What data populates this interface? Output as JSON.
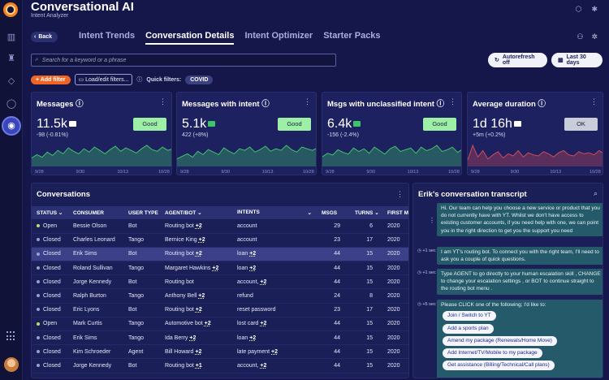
{
  "app": {
    "title": "Conversational AI",
    "subtitle": "Intent Analyzer"
  },
  "nav": {
    "back_label": "Back",
    "tabs": [
      {
        "label": "Intent Trends",
        "active": false
      },
      {
        "label": "Conversation Details",
        "active": true
      },
      {
        "label": "Intent Optimizer",
        "active": false
      },
      {
        "label": "Starter Packs",
        "active": false
      }
    ]
  },
  "search": {
    "placeholder": "Search for a keyword or a phrase"
  },
  "autorefresh": {
    "label": "Autorefresh off"
  },
  "date_range": {
    "label": "Last 30 days"
  },
  "filters": {
    "add_label": "Add filter",
    "load_label": "Load/edit filters...",
    "quick_label": "Quick filters:",
    "chips": [
      "COVID"
    ]
  },
  "colors": {
    "good": "#9eefa6",
    "ok": "#c9ccd9",
    "positive_line": "#3fc36a",
    "negative_line": "#d14a5a",
    "accent_orange": "#f06424"
  },
  "kpis": [
    {
      "title": "Messages",
      "value": "11.5k",
      "delta": "-98 (-0.81%)",
      "status": "Good",
      "status_type": "good",
      "trend": "positive",
      "icon": "trend-flat-icon",
      "x_ticks": [
        "9/28",
        "9/30",
        "10/13",
        "10/28"
      ],
      "series": [
        20,
        28,
        22,
        34,
        26,
        38,
        30,
        44,
        36,
        30,
        42,
        34,
        46,
        38,
        30,
        40,
        48,
        36,
        44,
        38,
        32,
        42,
        50,
        40,
        36,
        46,
        38,
        42
      ]
    },
    {
      "title": "Messages with intent",
      "value": "5.1k",
      "delta": "422 (+8%)",
      "status": "Good",
      "status_type": "good",
      "trend": "positive",
      "icon": "trend-up-icon",
      "x_ticks": [
        "9/28",
        "9/30",
        "10/13",
        "10/28"
      ],
      "series": [
        18,
        24,
        30,
        22,
        36,
        28,
        40,
        34,
        28,
        44,
        36,
        30,
        42,
        38,
        46,
        34,
        40,
        48,
        36,
        42,
        38,
        50,
        40,
        34,
        46,
        42,
        38,
        44
      ]
    },
    {
      "title": "Msgs with unclassified intent",
      "value": "6.4k",
      "delta": "-156 (-2.4%)",
      "status": "Good",
      "status_type": "good",
      "trend": "positive",
      "icon": "trend-down-icon",
      "x_ticks": [
        "9/28",
        "9/30",
        "10/13",
        "10/28"
      ],
      "series": [
        22,
        30,
        26,
        38,
        32,
        28,
        42,
        34,
        40,
        30,
        44,
        36,
        28,
        40,
        46,
        34,
        38,
        42,
        30,
        44,
        36,
        40,
        48,
        34,
        38,
        44,
        32,
        40
      ]
    },
    {
      "title": "Average duration",
      "value": "1d 16h",
      "delta": "+5m (+0.2%)",
      "status": "OK",
      "status_type": "ok",
      "trend": "negative",
      "icon": "trend-flat-icon",
      "x_ticks": [
        "9/28",
        "9/30",
        "10/13",
        "10/28"
      ],
      "series": [
        12,
        40,
        18,
        30,
        14,
        22,
        28,
        16,
        24,
        20,
        30,
        18,
        26,
        22,
        20,
        28,
        24,
        18,
        26,
        30,
        22,
        20,
        28,
        24,
        26,
        22,
        30,
        24
      ]
    }
  ],
  "conversations": {
    "title": "Conversations",
    "columns": [
      "STATUS",
      "CONSUMER",
      "USER TYPE",
      "AGENT/BOT",
      "INTENTS",
      "MSGS",
      "TURNS",
      "FIRST M"
    ],
    "rows": [
      {
        "status": "Open",
        "consumer": "Bessie Olson",
        "user_type": "Bot",
        "agent": "Routing bot",
        "agent_more": "+2",
        "intents": "account",
        "intents_more": "",
        "msgs": "29",
        "turns": "6",
        "first": "2020"
      },
      {
        "status": "Closed",
        "consumer": "Charles Leonard",
        "user_type": "Tango",
        "agent": "Bernice King",
        "agent_more": "+2",
        "intents": "account",
        "intents_more": "",
        "msgs": "23",
        "turns": "17",
        "first": "2020"
      },
      {
        "status": "Closed",
        "consumer": "Erik Sims",
        "user_type": "Bot",
        "agent": "Routing bot",
        "agent_more": "+2",
        "intents": "loan",
        "intents_more": "+2",
        "msgs": "44",
        "turns": "15",
        "first": "2020",
        "selected": true
      },
      {
        "status": "Closed",
        "consumer": "Roland Sullivan",
        "user_type": "Tango",
        "agent": "Margaret Hawkins",
        "agent_more": "+2",
        "intents": "loan",
        "intents_more": "+2",
        "msgs": "44",
        "turns": "15",
        "first": "2020"
      },
      {
        "status": "Closed",
        "consumer": "Jorge Kennedy",
        "user_type": "Bot",
        "agent": "Routing bot",
        "agent_more": "",
        "intents": "account,",
        "intents_more": "+2",
        "msgs": "44",
        "turns": "15",
        "first": "2020"
      },
      {
        "status": "Closed",
        "consumer": "Ralph Burton",
        "user_type": "Tango",
        "agent": "Anthony Bell",
        "agent_more": "+2",
        "intents": "refund",
        "intents_more": "",
        "msgs": "24",
        "turns": "8",
        "first": "2020"
      },
      {
        "status": "Closed",
        "consumer": "Eric Lyons",
        "user_type": "Bot",
        "agent": "Routing bot",
        "agent_more": "+2",
        "intents": "reset password",
        "intents_more": "",
        "msgs": "23",
        "turns": "17",
        "first": "2020"
      },
      {
        "status": "Open",
        "consumer": "Mark Curtis",
        "user_type": "Tango",
        "agent": "Automotive bot",
        "agent_more": "+2",
        "intents": "lost card",
        "intents_more": "+2",
        "msgs": "44",
        "turns": "15",
        "first": "2020"
      },
      {
        "status": "Closed",
        "consumer": "Erik Sims",
        "user_type": "Tango",
        "agent": "Ida Berry",
        "agent_more": "+2",
        "intents": "loan",
        "intents_more": "+2",
        "msgs": "44",
        "turns": "15",
        "first": "2020"
      },
      {
        "status": "Closed",
        "consumer": "Kim Schroeder",
        "user_type": "Agent",
        "agent": "Bill Howard",
        "agent_more": "+2",
        "intents": "late payment",
        "intents_more": "+2",
        "msgs": "44",
        "turns": "15",
        "first": "2020"
      },
      {
        "status": "Closed",
        "consumer": "Jorge Kennedy",
        "user_type": "Bot",
        "agent": "Routing bot",
        "agent_more": "+1",
        "intents": "account,",
        "intents_more": "+2",
        "msgs": "44",
        "turns": "15",
        "first": "2020"
      }
    ]
  },
  "transcript": {
    "title": "Erik's conversation transcript",
    "messages": [
      {
        "meta": "",
        "text": "Hi. Our team can help you choose a new service or product that you do not currently have with YT. Whilst we don't have access to existing customer accounts, if you need help with one, we can point you in the right direction to get you the support you need"
      },
      {
        "meta": "+1 sec",
        "text": "I am YT's routing bot. To connect you with the right team, I'll need to ask you a couple of quick questions."
      },
      {
        "meta": "+1 sec",
        "text": "Type AGENT to go directly to your human escalation skill , CHANGE to change your escalation settings , or BOT to continue straight to the routing bot menu ."
      },
      {
        "meta": "+5 sec",
        "text": "Please CLICK one of the following; I'd like to:"
      }
    ],
    "options": [
      "Join / Switch to YT",
      "Add a sports plan",
      "Amend my package (Renewals/Home Move)",
      "Add Internet/TV/Mobile to my package",
      "Get assistance (Billing/Technical/Call plans)"
    ]
  }
}
